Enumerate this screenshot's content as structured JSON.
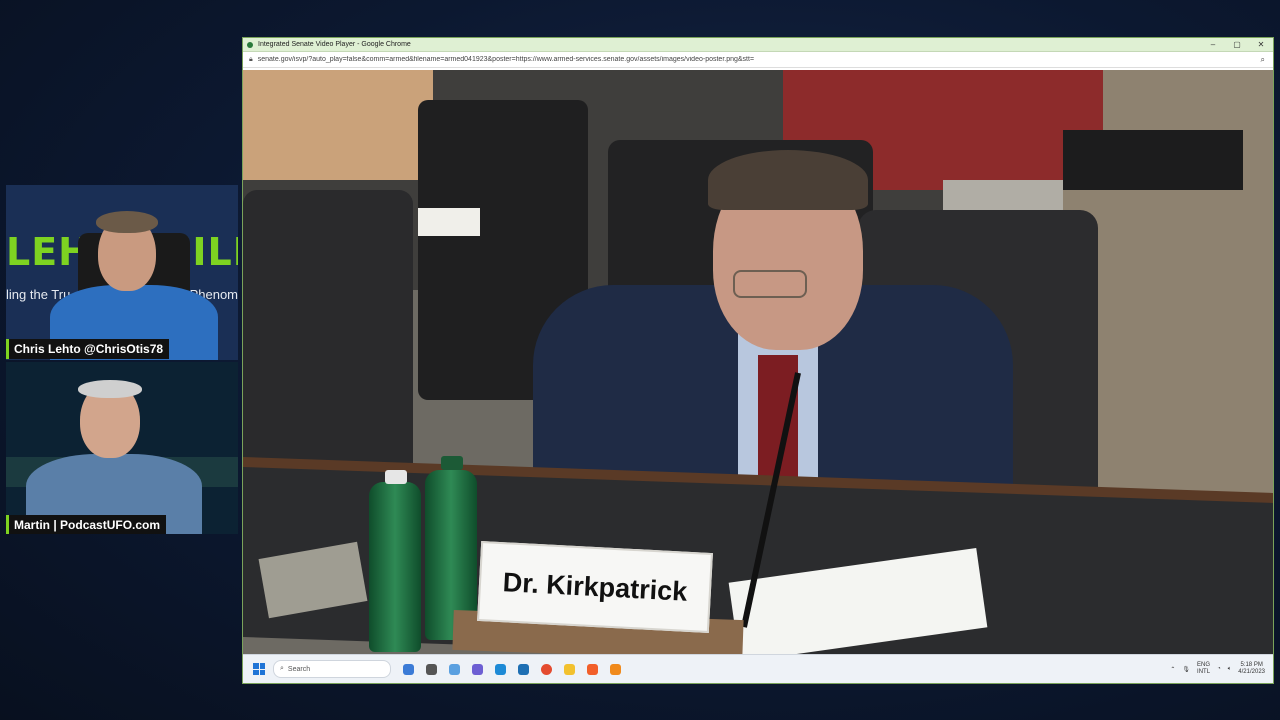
{
  "overlay": {
    "banner_text": "LEHTO FILES",
    "banner_sub_left": "ling the Tru",
    "banner_sub_right": "Phenom",
    "host1_name": "Chris Lehto @ChrisOtis78",
    "host2_name": "Martin | PodcastUFO.com"
  },
  "browser": {
    "window_title": "Integrated Senate Video Player - Google Chrome",
    "url": "senate.gov/isvp/?auto_play=false&comm=armed&filename=armed041923&poster=https://www.armed-services.senate.gov/assets/images/video-poster.png&stt=",
    "minimize": "–",
    "maximize": "▢",
    "close": "✕"
  },
  "video": {
    "nameplate": "Dr. Kirkpatrick",
    "reserved_card": "_____"
  },
  "taskbar": {
    "search_placeholder": "Search",
    "lang_top": "ENG",
    "lang_bottom": "INTL",
    "time": "5:18 PM",
    "date": "4/21/2023"
  },
  "colors": {
    "accent_green": "#7ed321",
    "page_bg": "#0d1a2f",
    "titlebar_bg": "#dff0d3"
  }
}
